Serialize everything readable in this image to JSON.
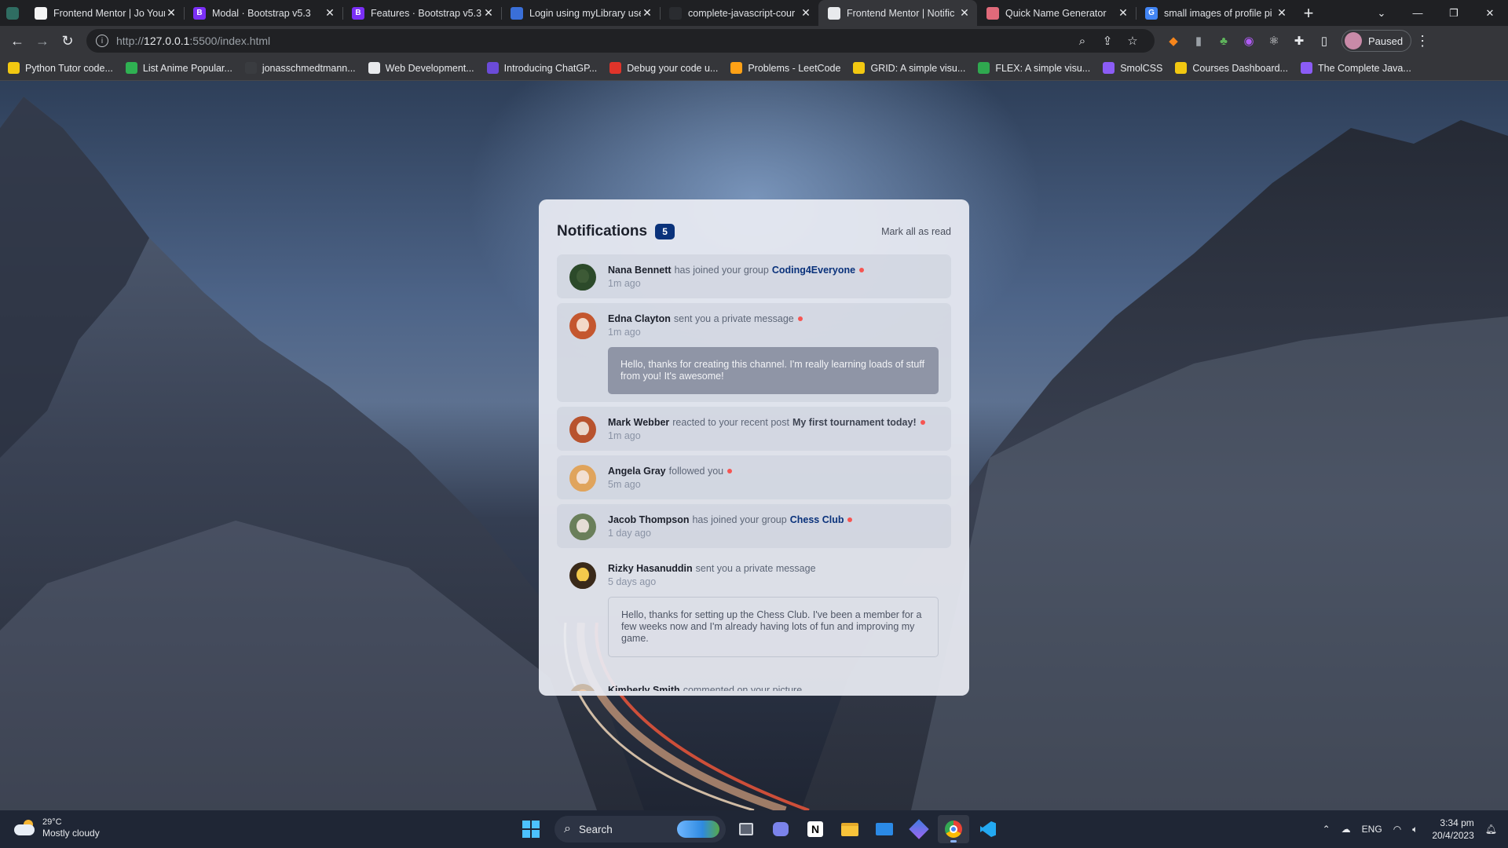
{
  "browser": {
    "tabs": [
      {
        "title": "Frontend Mentor | Jo Your",
        "fav_color": "#f4f4f4",
        "fav_text": ""
      },
      {
        "title": "Modal · Bootstrap v5.3",
        "fav_color": "#7b2ff7",
        "fav_text": "B"
      },
      {
        "title": "Features · Bootstrap v5.3",
        "fav_color": "#7b2ff7",
        "fav_text": "B"
      },
      {
        "title": "Login using myLibrary use",
        "fav_color": "#3a6fd8",
        "fav_text": ""
      },
      {
        "title": "complete-javascript-cour",
        "fav_color": "#2a2c30",
        "fav_text": ""
      },
      {
        "title": "Frontend Mentor | Notific",
        "fav_color": "#e8eaed",
        "fav_text": ""
      },
      {
        "title": "Quick Name Generator",
        "fav_color": "#e06a7a",
        "fav_text": ""
      },
      {
        "title": "small images of profile pi",
        "fav_color": "#4285f4",
        "fav_text": "G"
      }
    ],
    "active_tab": 5,
    "url_prefix": "http://",
    "url_host": "127.0.0.1",
    "url_path": ":5500/index.html",
    "profile_status": "Paused",
    "bookmarks": [
      {
        "label": "Python Tutor code...",
        "color": "#f2c811"
      },
      {
        "label": "List Anime Popular...",
        "color": "#2fb152"
      },
      {
        "label": "jonasschmedtmann...",
        "color": "#3a3c40"
      },
      {
        "label": "Web Development...",
        "color": "#e8eaed"
      },
      {
        "label": "Introducing ChatGP...",
        "color": "#6b4bd8"
      },
      {
        "label": "Debug your code u...",
        "color": "#e0342a"
      },
      {
        "label": "Problems - LeetCode",
        "color": "#ffa116"
      },
      {
        "label": "GRID: A simple visu...",
        "color": "#f2c811"
      },
      {
        "label": "FLEX: A simple visu...",
        "color": "#2fa84f"
      },
      {
        "label": "SmolCSS",
        "color": "#8b5cf6"
      },
      {
        "label": "Courses Dashboard...",
        "color": "#f2c811"
      },
      {
        "label": "The Complete Java...",
        "color": "#8b5cf6"
      }
    ]
  },
  "notifications": {
    "title": "Notifications",
    "count": "5",
    "mark_all": "Mark all as read",
    "items": [
      {
        "name": "Nana Bennett",
        "action": "has joined your group",
        "group": "Coding4Everyone",
        "time": "1m ago",
        "unread": true,
        "skin": "#3d5a36",
        "shirt": "#2c4a2a"
      },
      {
        "name": "Edna Clayton",
        "action": "sent you a private message",
        "time": "1m ago",
        "unread": true,
        "message": "Hello, thanks for creating this channel. I'm really learning loads of stuff from you! It's awesome!",
        "skin": "#f3d9c8",
        "shirt": "#c4572f"
      },
      {
        "name": "Mark Webber",
        "action": "reacted to your recent post",
        "post": "My first tournament today!",
        "time": "1m ago",
        "unread": true,
        "skin": "#e9d8cd",
        "shirt": "#b8532e"
      },
      {
        "name": "Angela Gray",
        "action": "followed you",
        "time": "5m ago",
        "unread": true,
        "skin": "#f2dfd2",
        "shirt": "#e0a45c"
      },
      {
        "name": "Jacob Thompson",
        "action": "has joined your group",
        "group": "Chess Club",
        "time": "1 day ago",
        "unread": true,
        "skin": "#e5ddd5",
        "shirt": "#6a7f5a"
      },
      {
        "name": "Rizky Hasanuddin",
        "action": "sent you a private message",
        "time": "5 days ago",
        "unread": false,
        "message": "Hello, thanks for setting up the Chess Club. I've been a member for a few weeks now and I'm already having lots of fun and improving my game.",
        "skin": "#f2c94c",
        "shirt": "#3a2a1a"
      },
      {
        "name": "Kimberly Smith",
        "action": "commented on your picture",
        "unread": false
      }
    ]
  },
  "taskbar": {
    "temperature": "29°C",
    "condition": "Mostly cloudy",
    "search": "Search",
    "language": "ENG",
    "time": "3:34 pm",
    "date": "20/4/2023"
  }
}
